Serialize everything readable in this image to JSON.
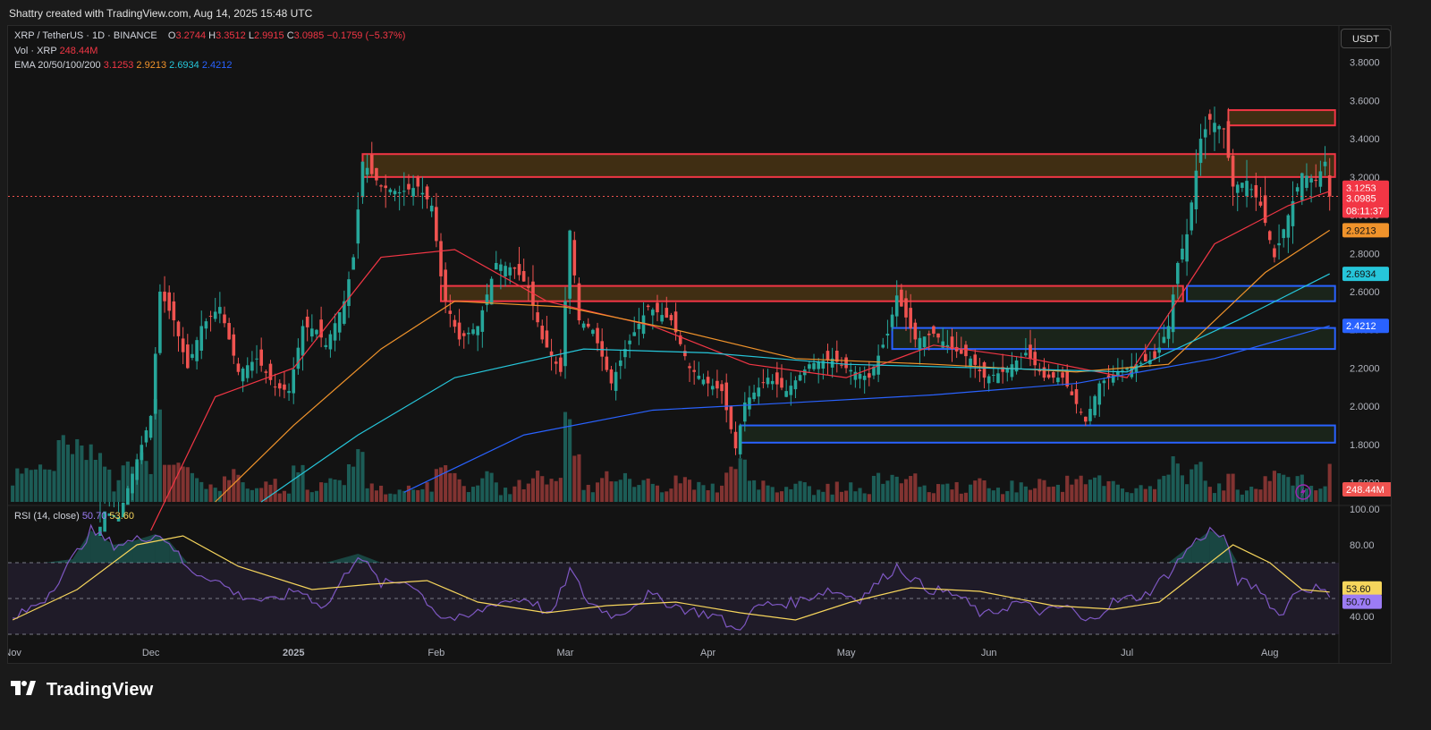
{
  "header": {
    "text": "Shattry created with TradingView.com, Aug 14, 2025 15:48 UTC"
  },
  "legend": {
    "symbol": "XRP / TetherUS · 1D · BINANCE",
    "o_label": "O",
    "o": "3.2744",
    "h_label": "H",
    "h": "3.3512",
    "l_label": "L",
    "l": "2.9915",
    "c_label": "C",
    "c": "3.0985",
    "change": "−0.1759 (−5.37%)",
    "vol_label": "Vol · XRP",
    "vol": "248.44M",
    "ema_label": "EMA 20/50/100/200",
    "ema20": "3.1253",
    "ema50": "2.9213",
    "ema100": "2.6934",
    "ema200": "2.4212",
    "rsi_label": "RSI (14, close)",
    "rsi": "50.70",
    "rsi_ma": "53.60"
  },
  "unit_button": "USDT",
  "brand": {
    "name": "TradingView",
    "logo": "tradingview-logo-icon"
  },
  "colors": {
    "up": "#26a69a",
    "down": "#ef5350",
    "ema20": "#f23645",
    "ema50": "#f0932b",
    "ema100": "#26c6da",
    "ema200": "#2962ff",
    "rsi": "#7e57c2",
    "rsi_ma": "#f6d55c",
    "resistance_box": "#f23645",
    "support_box": "#2962ff"
  },
  "chart_data": [
    {
      "type": "candlestick",
      "pane": "price",
      "ylim": [
        1.5,
        3.85
      ],
      "y_ticks": [
        "3.8000",
        "3.6000",
        "3.4000",
        "3.2000",
        "3.0000",
        "2.8000",
        "2.6000",
        "2.4000",
        "2.2000",
        "2.0000",
        "1.8000",
        "1.6000"
      ],
      "x_ticks": [
        "Nov",
        "Dec",
        "2025",
        "Feb",
        "Mar",
        "Apr",
        "May",
        "Jun",
        "Jul",
        "Aug"
      ],
      "price_labels": [
        {
          "value": "3.1253",
          "y": 3.1253,
          "color": "#f23645"
        },
        {
          "value": "3.0985",
          "y": 3.0985,
          "color": "#f23645"
        },
        {
          "value": "08:11:37",
          "y": 3.0,
          "color": "#f23645"
        },
        {
          "value": "2.9213",
          "y": 2.9213,
          "color": "#f0932b"
        },
        {
          "value": "2.6934",
          "y": 2.6934,
          "color": "#26c6da"
        },
        {
          "value": "2.4212",
          "y": 2.4212,
          "color": "#2962ff"
        }
      ],
      "current_price": 3.0985,
      "close_path": [
        [
          "2024-11-01",
          0.52
        ],
        [
          "2024-11-10",
          0.66
        ],
        [
          "2024-11-17",
          1.13
        ],
        [
          "2024-11-21",
          1.45
        ],
        [
          "2024-11-24",
          1.42
        ],
        [
          "2024-12-01",
          1.95
        ],
        [
          "2024-12-03",
          2.6
        ],
        [
          "2024-12-06",
          2.45
        ],
        [
          "2024-12-09",
          2.2
        ],
        [
          "2024-12-12",
          2.42
        ],
        [
          "2024-12-16",
          2.52
        ],
        [
          "2024-12-20",
          2.18
        ],
        [
          "2024-12-24",
          2.25
        ],
        [
          "2024-12-28",
          2.1
        ],
        [
          "2024-12-31",
          2.08
        ],
        [
          "2025-01-03",
          2.42
        ],
        [
          "2025-01-06",
          2.4
        ],
        [
          "2025-01-08",
          2.32
        ],
        [
          "2025-01-12",
          2.55
        ],
        [
          "2025-01-14",
          2.78
        ],
        [
          "2025-01-16",
          3.28
        ],
        [
          "2025-01-20",
          3.15
        ],
        [
          "2025-01-24",
          3.12
        ],
        [
          "2025-01-28",
          3.15
        ],
        [
          "2025-01-31",
          3.05
        ],
        [
          "2025-02-02",
          2.68
        ],
        [
          "2025-02-03",
          2.55
        ],
        [
          "2025-02-06",
          2.35
        ],
        [
          "2025-02-10",
          2.42
        ],
        [
          "2025-02-14",
          2.75
        ],
        [
          "2025-02-18",
          2.72
        ],
        [
          "2025-02-21",
          2.62
        ],
        [
          "2025-02-24",
          2.35
        ],
        [
          "2025-02-28",
          2.18
        ],
        [
          "2025-03-02",
          2.92
        ],
        [
          "2025-03-04",
          2.45
        ],
        [
          "2025-03-07",
          2.4
        ],
        [
          "2025-03-11",
          2.12
        ],
        [
          "2025-03-14",
          2.3
        ],
        [
          "2025-03-19",
          2.52
        ],
        [
          "2025-03-24",
          2.45
        ],
        [
          "2025-03-28",
          2.2
        ],
        [
          "2025-04-01",
          2.12
        ],
        [
          "2025-04-04",
          2.08
        ],
        [
          "2025-04-07",
          1.78
        ],
        [
          "2025-04-09",
          2.02
        ],
        [
          "2025-04-14",
          2.15
        ],
        [
          "2025-04-18",
          2.08
        ],
        [
          "2025-04-23",
          2.22
        ],
        [
          "2025-04-28",
          2.25
        ],
        [
          "2025-05-01",
          2.2
        ],
        [
          "2025-05-06",
          2.15
        ],
        [
          "2025-05-10",
          2.38
        ],
        [
          "2025-05-12",
          2.58
        ],
        [
          "2025-05-16",
          2.35
        ],
        [
          "2025-05-20",
          2.38
        ],
        [
          "2025-05-24",
          2.3
        ],
        [
          "2025-05-28",
          2.25
        ],
        [
          "2025-05-31",
          2.15
        ],
        [
          "2025-06-04",
          2.18
        ],
        [
          "2025-06-09",
          2.28
        ],
        [
          "2025-06-13",
          2.15
        ],
        [
          "2025-06-17",
          2.15
        ],
        [
          "2025-06-22",
          1.92
        ],
        [
          "2025-06-25",
          2.12
        ],
        [
          "2025-06-29",
          2.18
        ],
        [
          "2025-07-03",
          2.22
        ],
        [
          "2025-07-07",
          2.25
        ],
        [
          "2025-07-10",
          2.42
        ],
        [
          "2025-07-12",
          2.75
        ],
        [
          "2025-07-14",
          2.9
        ],
        [
          "2025-07-17",
          3.4
        ],
        [
          "2025-07-19",
          3.5
        ],
        [
          "2025-07-22",
          3.45
        ],
        [
          "2025-07-24",
          3.15
        ],
        [
          "2025-07-27",
          3.18
        ],
        [
          "2025-07-30",
          3.05
        ],
        [
          "2025-08-02",
          2.78
        ],
        [
          "2025-08-05",
          3.0
        ],
        [
          "2025-08-08",
          3.22
        ],
        [
          "2025-08-11",
          3.18
        ],
        [
          "2025-08-13",
          3.28
        ],
        [
          "2025-08-14",
          3.0985
        ]
      ],
      "ema_curves": {
        "ema20": [
          [
            "2024-12-01",
            1.35
          ],
          [
            "2024-12-15",
            2.05
          ],
          [
            "2025-01-01",
            2.2
          ],
          [
            "2025-01-20",
            2.78
          ],
          [
            "2025-02-05",
            2.82
          ],
          [
            "2025-02-25",
            2.55
          ],
          [
            "2025-03-20",
            2.42
          ],
          [
            "2025-04-10",
            2.22
          ],
          [
            "2025-05-01",
            2.15
          ],
          [
            "2025-05-20",
            2.32
          ],
          [
            "2025-06-10",
            2.25
          ],
          [
            "2025-07-01",
            2.15
          ],
          [
            "2025-07-20",
            2.85
          ],
          [
            "2025-08-05",
            3.05
          ],
          [
            "2025-08-14",
            3.1253
          ]
        ],
        "ema50": [
          [
            "2024-12-15",
            1.5
          ],
          [
            "2025-01-01",
            1.9
          ],
          [
            "2025-01-20",
            2.3
          ],
          [
            "2025-02-05",
            2.55
          ],
          [
            "2025-03-01",
            2.52
          ],
          [
            "2025-03-25",
            2.4
          ],
          [
            "2025-04-20",
            2.25
          ],
          [
            "2025-05-20",
            2.22
          ],
          [
            "2025-06-20",
            2.18
          ],
          [
            "2025-07-10",
            2.22
          ],
          [
            "2025-07-31",
            2.7
          ],
          [
            "2025-08-14",
            2.9213
          ]
        ],
        "ema100": [
          [
            "2024-12-25",
            1.5
          ],
          [
            "2025-01-15",
            1.85
          ],
          [
            "2025-02-05",
            2.15
          ],
          [
            "2025-03-05",
            2.3
          ],
          [
            "2025-04-01",
            2.28
          ],
          [
            "2025-05-01",
            2.22
          ],
          [
            "2025-06-01",
            2.2
          ],
          [
            "2025-07-01",
            2.18
          ],
          [
            "2025-07-25",
            2.45
          ],
          [
            "2025-08-14",
            2.6934
          ]
        ],
        "ema200": [
          [
            "2025-01-25",
            1.55
          ],
          [
            "2025-02-20",
            1.85
          ],
          [
            "2025-03-20",
            1.98
          ],
          [
            "2025-04-20",
            2.02
          ],
          [
            "2025-05-20",
            2.06
          ],
          [
            "2025-06-20",
            2.12
          ],
          [
            "2025-07-20",
            2.25
          ],
          [
            "2025-08-14",
            2.4212
          ]
        ]
      },
      "zones": [
        {
          "kind": "resistance",
          "x0": "2025-01-16",
          "x1": "2025-08-14",
          "y0": 3.2,
          "y1": 3.32
        },
        {
          "kind": "resistance",
          "x0": "2025-07-23",
          "x1": "2025-08-14",
          "y0": 3.47,
          "y1": 3.55
        },
        {
          "kind": "resistance",
          "x0": "2025-02-02",
          "x1": "2025-07-12",
          "y0": 2.55,
          "y1": 2.63
        },
        {
          "kind": "support",
          "x0": "2025-07-14",
          "x1": "2025-08-14",
          "y0": 2.55,
          "y1": 2.63
        },
        {
          "kind": "support",
          "x0": "2025-05-11",
          "x1": "2025-08-14",
          "y0": 2.3,
          "y1": 2.41
        },
        {
          "kind": "support",
          "x0": "2025-04-08",
          "x1": "2025-08-14",
          "y0": 1.81,
          "y1": 1.9
        }
      ]
    },
    {
      "type": "bar",
      "pane": "volume",
      "series_name": "Vol · XRP",
      "last_value": "248.44M"
    },
    {
      "type": "line",
      "pane": "rsi",
      "ylim": [
        25,
        100
      ],
      "y_ticks": [
        "100.00",
        "80.00",
        "40.00"
      ],
      "bands": {
        "upper": 70,
        "middle": 50,
        "lower": 30
      },
      "labels": [
        {
          "value": "53.60",
          "y": 53.6,
          "color": "#f6d55c"
        },
        {
          "value": "50.70",
          "y": 50.7,
          "color": "#9c7cf4"
        }
      ],
      "rsi": [
        [
          "2024-11-01",
          38
        ],
        [
          "2024-11-08",
          50
        ],
        [
          "2024-11-14",
          72
        ],
        [
          "2024-11-18",
          88
        ],
        [
          "2024-11-23",
          80
        ],
        [
          "2024-11-27",
          82
        ],
        [
          "2024-12-02",
          86
        ],
        [
          "2024-12-05",
          82
        ],
        [
          "2024-12-09",
          66
        ],
        [
          "2024-12-14",
          62
        ],
        [
          "2024-12-20",
          52
        ],
        [
          "2024-12-27",
          48
        ],
        [
          "2025-01-02",
          55
        ],
        [
          "2025-01-08",
          45
        ],
        [
          "2025-01-15",
          75
        ],
        [
          "2025-01-20",
          58
        ],
        [
          "2025-01-26",
          60
        ],
        [
          "2025-02-02",
          40
        ],
        [
          "2025-02-07",
          38
        ],
        [
          "2025-02-14",
          48
        ],
        [
          "2025-02-21",
          50
        ],
        [
          "2025-02-26",
          40
        ],
        [
          "2025-03-02",
          66
        ],
        [
          "2025-03-06",
          48
        ],
        [
          "2025-03-12",
          40
        ],
        [
          "2025-03-19",
          52
        ],
        [
          "2025-03-27",
          44
        ],
        [
          "2025-04-03",
          40
        ],
        [
          "2025-04-07",
          32
        ],
        [
          "2025-04-12",
          46
        ],
        [
          "2025-04-20",
          48
        ],
        [
          "2025-04-27",
          55
        ],
        [
          "2025-05-04",
          50
        ],
        [
          "2025-05-12",
          68
        ],
        [
          "2025-05-18",
          56
        ],
        [
          "2025-05-25",
          52
        ],
        [
          "2025-05-31",
          40
        ],
        [
          "2025-06-07",
          48
        ],
        [
          "2025-06-13",
          42
        ],
        [
          "2025-06-18",
          46
        ],
        [
          "2025-06-22",
          36
        ],
        [
          "2025-06-28",
          48
        ],
        [
          "2025-07-05",
          52
        ],
        [
          "2025-07-10",
          64
        ],
        [
          "2025-07-15",
          80
        ],
        [
          "2025-07-19",
          88
        ],
        [
          "2025-07-22",
          84
        ],
        [
          "2025-07-25",
          60
        ],
        [
          "2025-07-30",
          55
        ],
        [
          "2025-08-03",
          40
        ],
        [
          "2025-08-07",
          55
        ],
        [
          "2025-08-11",
          56
        ],
        [
          "2025-08-14",
          50.7
        ]
      ],
      "rsi_ma": [
        [
          "2024-11-01",
          38
        ],
        [
          "2024-11-15",
          55
        ],
        [
          "2024-11-28",
          80
        ],
        [
          "2024-12-08",
          85
        ],
        [
          "2024-12-20",
          68
        ],
        [
          "2025-01-05",
          55
        ],
        [
          "2025-01-18",
          58
        ],
        [
          "2025-01-30",
          60
        ],
        [
          "2025-02-10",
          48
        ],
        [
          "2025-02-25",
          42
        ],
        [
          "2025-03-10",
          46
        ],
        [
          "2025-03-25",
          48
        ],
        [
          "2025-04-08",
          42
        ],
        [
          "2025-04-20",
          38
        ],
        [
          "2025-05-02",
          48
        ],
        [
          "2025-05-15",
          56
        ],
        [
          "2025-05-30",
          54
        ],
        [
          "2025-06-15",
          46
        ],
        [
          "2025-06-28",
          44
        ],
        [
          "2025-07-08",
          48
        ],
        [
          "2025-07-18",
          68
        ],
        [
          "2025-07-24",
          80
        ],
        [
          "2025-08-01",
          70
        ],
        [
          "2025-08-08",
          55
        ],
        [
          "2025-08-14",
          53.6
        ]
      ]
    }
  ]
}
